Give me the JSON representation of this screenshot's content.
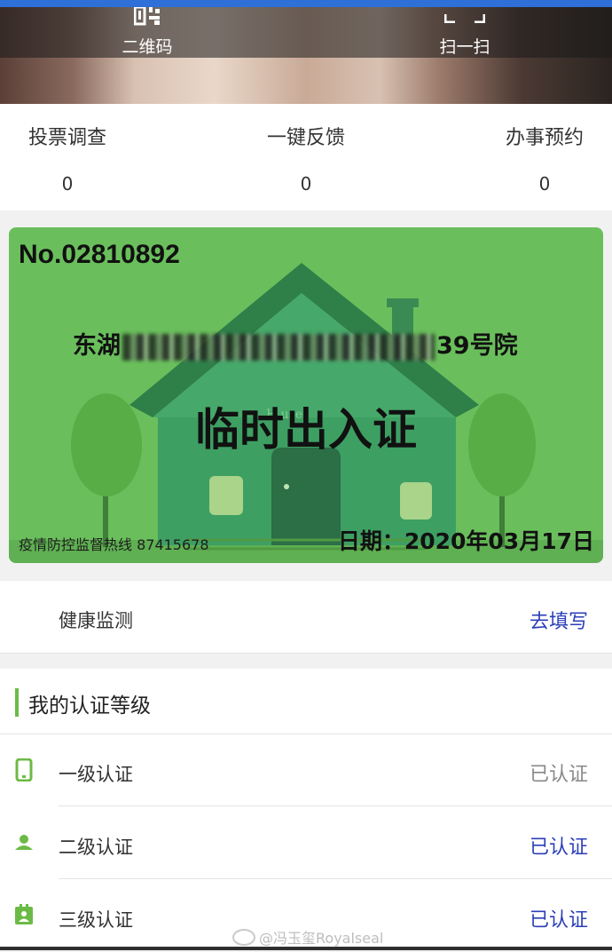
{
  "hero": {
    "qr_label": "二维码",
    "scan_label": "扫一扫",
    "qr_icon": "qr-code-icon",
    "scan_icon": "scan-icon"
  },
  "counters": [
    {
      "label": "投票调查",
      "value": "0"
    },
    {
      "label": "一键反馈",
      "value": "0"
    },
    {
      "label": "办事预约",
      "value": "0"
    }
  ],
  "pass_card": {
    "number": "No.02810892",
    "address_prefix": "东湖",
    "address_suffix": "39号院",
    "title": "临时出入证",
    "hotline": "疫情防控监督热线 87415678",
    "date": "日期：2020年03月17日",
    "house_sign": "H   use",
    "color": "#6abf5c"
  },
  "health": {
    "label": "健康监测",
    "action": "去填写"
  },
  "certification": {
    "title": "我的认证等级",
    "accent_color": "#6cba46",
    "levels": [
      {
        "label": "一级认证",
        "status": "已认证",
        "icon": "phone-icon"
      },
      {
        "label": "二级认证",
        "status": "已认证",
        "icon": "person-icon"
      },
      {
        "label": "三级认证",
        "status": "已认证",
        "icon": "id-badge-icon"
      }
    ]
  },
  "watermark": "@冯玉玺Royalseal"
}
